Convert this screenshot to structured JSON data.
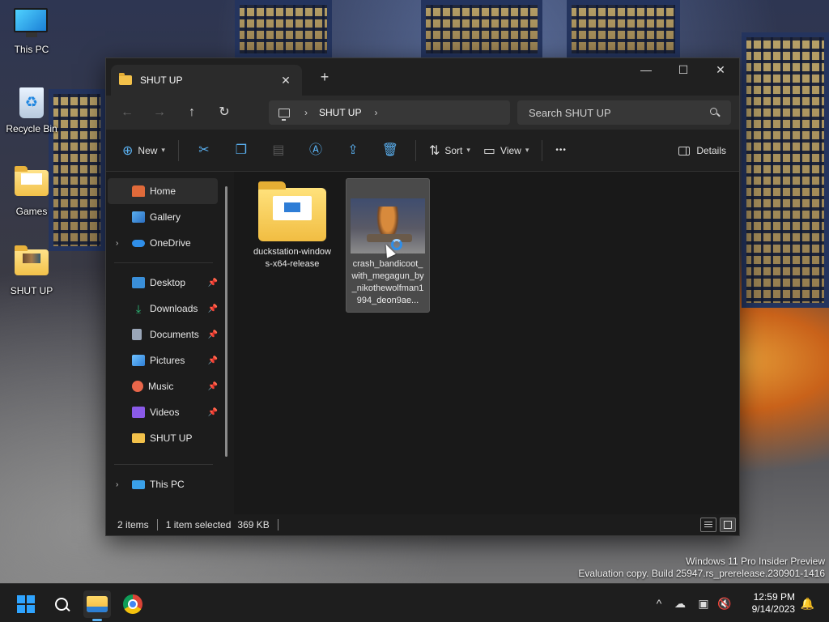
{
  "desktop": {
    "icons": [
      {
        "label": "This PC"
      },
      {
        "label": "Recycle Bin"
      },
      {
        "label": "Games"
      },
      {
        "label": "SHUT UP"
      }
    ]
  },
  "window": {
    "tab_title": "SHUT UP",
    "tab_close": "✕",
    "new_tab": "+",
    "controls": {
      "minimize": "—",
      "maximize": "☐",
      "close": "✕"
    },
    "nav": {
      "back": "←",
      "forward": "→",
      "up": "↑",
      "refresh": "↻"
    },
    "address": {
      "separator": "›",
      "crumb": "SHUT UP",
      "crumb_sep": "›"
    },
    "search": {
      "placeholder": "Search SHUT UP"
    },
    "toolbar": {
      "new_label": "New",
      "sort_label": "Sort",
      "view_label": "View",
      "more": "•••",
      "details_label": "Details"
    },
    "sidebar": {
      "home": "Home",
      "gallery": "Gallery",
      "onedrive": "OneDrive",
      "quick": [
        {
          "label": "Desktop",
          "color": "#3a8fd9"
        },
        {
          "label": "Downloads",
          "color": "#2dbf7a"
        },
        {
          "label": "Documents",
          "color": "#9aa6b8"
        },
        {
          "label": "Pictures",
          "color": "#4aa3e8"
        },
        {
          "label": "Music",
          "color": "#e8664a"
        },
        {
          "label": "Videos",
          "color": "#8a5ae8"
        },
        {
          "label": "SHUT UP",
          "color": "#f2c14a"
        }
      ],
      "this_pc": "This PC"
    },
    "files": [
      {
        "name": "duckstation-windows-x64-release"
      },
      {
        "name": "crash_bandicoot_with_megagun_by_nikothewolfman1994_deon9ae..."
      }
    ],
    "status": {
      "items": "2 items",
      "selected": "1 item selected",
      "size": "369 KB"
    }
  },
  "watermark": {
    "line1": "Windows 11 Pro Insider Preview",
    "line2": "Evaluation copy. Build 25947.rs_prerelease.230901-1416"
  },
  "taskbar": {
    "time": "12:59 PM",
    "date": "9/14/2023",
    "tray_chevron": "^"
  }
}
